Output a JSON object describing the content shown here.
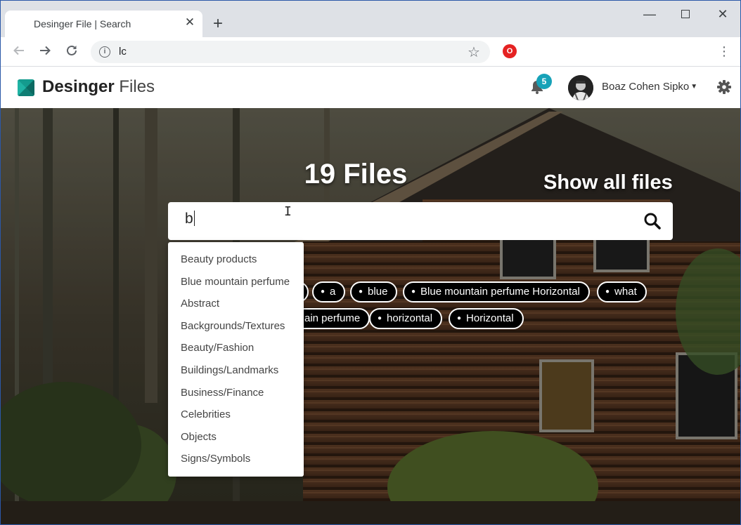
{
  "browser": {
    "tab_title": "Desinger File | Search",
    "tab_close": "✕",
    "new_tab": "+",
    "address": "lc",
    "window_controls": {
      "minimize": "—",
      "close": "✕"
    }
  },
  "header": {
    "logo_bold": "Desinger",
    "logo_light": "Files",
    "notification_count": "5",
    "user_name": "Boaz Cohen Sipko",
    "accent_color": "#17a2b8"
  },
  "hero": {
    "title": "19 Files",
    "show_all": "Show all files"
  },
  "search": {
    "value": "b"
  },
  "tags": {
    "row1": [
      "a",
      "blue",
      "Blue mountain perfume Horizontal",
      "what"
    ],
    "row2_partial": "ain perfume",
    "row2": [
      "horizontal",
      "Horizontal"
    ]
  },
  "suggestions": [
    "Beauty products",
    "Blue mountain perfume",
    "Abstract",
    "Backgrounds/Textures",
    "Beauty/Fashion",
    "Buildings/Landmarks",
    "Business/Finance",
    "Celebrities",
    "Objects",
    "Signs/Symbols"
  ],
  "icons": {
    "back": "arrow-left-icon",
    "forward": "arrow-right-icon",
    "reload": "reload-icon",
    "info": "info-icon",
    "star": "star-icon",
    "extension": "opera-extension-icon",
    "menu": "kebab-menu-icon",
    "bell": "bell-icon",
    "gear": "gear-icon",
    "search": "search-icon"
  }
}
